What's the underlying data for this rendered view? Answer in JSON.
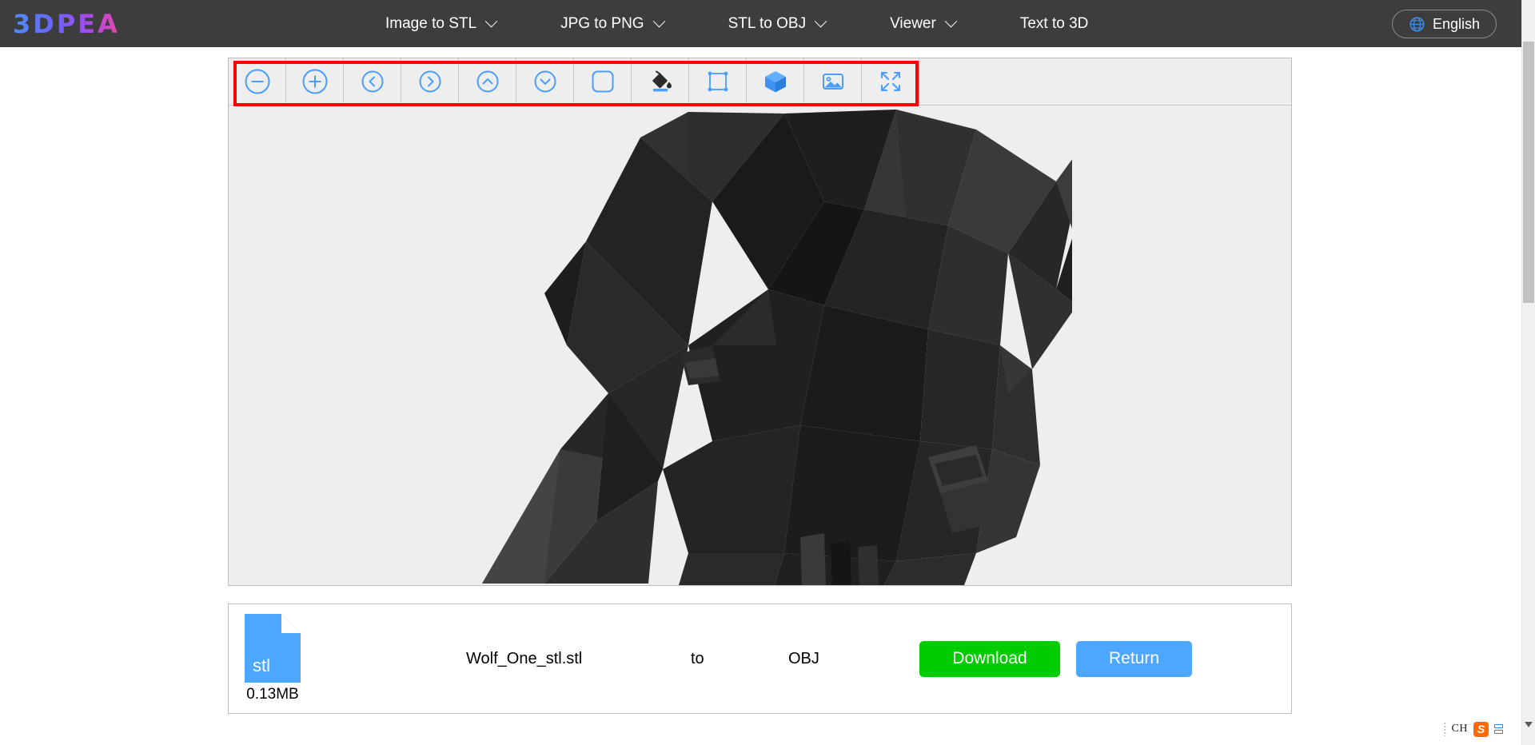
{
  "header": {
    "brand": "3DPEA",
    "nav_items": [
      {
        "label": "Image to STL",
        "icon": "chevron-down-icon",
        "has_dropdown": true
      },
      {
        "label": "JPG to PNG",
        "icon": "chevron-down-icon",
        "has_dropdown": true
      },
      {
        "label": "STL to OBJ",
        "icon": "chevron-down-icon",
        "has_dropdown": true
      },
      {
        "label": "Viewer",
        "icon": "chevron-down-icon",
        "has_dropdown": true
      },
      {
        "label": "Text to 3D",
        "icon": "",
        "has_dropdown": false
      }
    ],
    "language": {
      "label": "English",
      "icon": "globe-icon"
    },
    "background_color": "#3d3d3d"
  },
  "viewer": {
    "toolbar": [
      {
        "name": "zoom-out-button",
        "icon": "circle-minus-icon"
      },
      {
        "name": "zoom-in-button",
        "icon": "circle-plus-icon"
      },
      {
        "name": "rotate-left-button",
        "icon": "circle-chevron-left-icon"
      },
      {
        "name": "rotate-right-button",
        "icon": "circle-chevron-right-icon"
      },
      {
        "name": "rotate-up-button",
        "icon": "circle-chevron-up-icon"
      },
      {
        "name": "rotate-down-button",
        "icon": "circle-chevron-down-icon"
      },
      {
        "name": "background-button",
        "icon": "rounded-square-icon"
      },
      {
        "name": "fill-color-button",
        "icon": "paint-bucket-icon"
      },
      {
        "name": "bounding-box-button",
        "icon": "bounding-box-icon"
      },
      {
        "name": "solid-view-button",
        "icon": "cube-icon"
      },
      {
        "name": "screenshot-button",
        "icon": "image-icon"
      },
      {
        "name": "fullscreen-button",
        "icon": "expand-arrows-icon"
      }
    ],
    "highlight_color": "#ff0000",
    "model": "low-poly wolf head",
    "stage_background": "#eeeeee"
  },
  "file_card": {
    "file_type_label": "stl",
    "file_size": "0.13MB",
    "source_filename": "Wolf_One_stl.stl",
    "conversion_word": "to",
    "target_format": "OBJ",
    "download_label": "Download",
    "return_label": "Return",
    "download_color": "#00cc00",
    "return_color": "#4da6ff"
  },
  "ime_widget": {
    "mode": "CH",
    "logo": "S",
    "keyboard_icon": "keyboard-icon",
    "expand_icon": "chevron-down-icon"
  }
}
